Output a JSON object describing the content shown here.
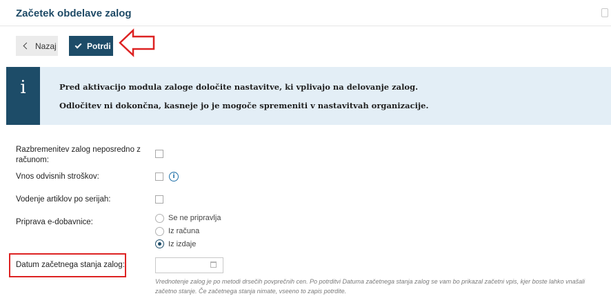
{
  "header": {
    "title": "Začetek obdelave zalog"
  },
  "toolbar": {
    "back_label": "Nazaj",
    "confirm_label": "Potrdi"
  },
  "info": {
    "line1": "Pred aktivacijo modula zaloge določite nastavitve, ki vplivajo na delovanje zalog.",
    "line2": "Odločitev ni dokončna, kasneje jo je mogoče spremeniti v nastavitvah organizacije."
  },
  "form": {
    "discharge_label_line1": "Razbremenitev zalog neposredno z",
    "discharge_label_line2": "računom:",
    "dependent_costs_label": "Vnos odvisnih stroškov:",
    "serial_label": "Vodenje artiklov po serijah:",
    "edispatch_label": "Priprava e-dobavnice:",
    "edispatch_options": [
      "Se ne pripravlja",
      "Iz računa",
      "Iz izdaje"
    ],
    "edispatch_selected": "Iz izdaje",
    "start_date_label": "Datum začetnega stanja zalog:",
    "start_date_value": "",
    "help_line1": "Vrednotenje zalog je po metodi drsečih povprečnih cen. Po potrditvi Datuma začetnega stanja zalog se vam bo prikazal začetni vpis, kjer boste lahko vnašali",
    "help_line2": "začetno stanje. Če začetnega stanja nimate, vseeno to zapis potrdite."
  },
  "colors": {
    "brand": "#1d4c68",
    "info_bg": "#e3eef6",
    "annotation": "#dd2222"
  }
}
